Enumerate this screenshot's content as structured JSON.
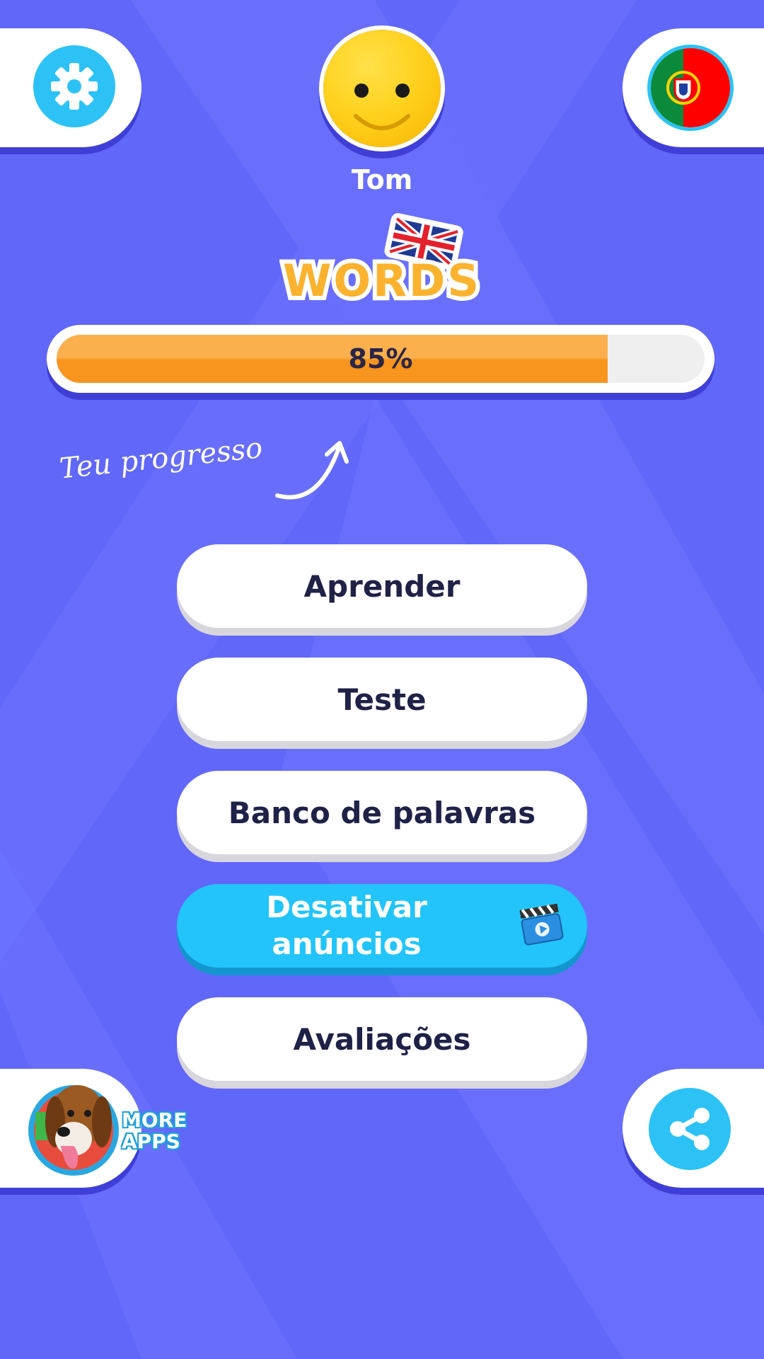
{
  "user": {
    "name": "Tom"
  },
  "logo": {
    "text": "WORDS"
  },
  "progress": {
    "percent": 85,
    "label": "85%"
  },
  "hint": {
    "text": "Teu progresso"
  },
  "menu": {
    "learn": "Aprender",
    "test": "Teste",
    "word_bank": "Banco de palavras",
    "remove_ads_line1": "Desativar",
    "remove_ads_line2": "anúncios",
    "reviews": "Avaliações"
  },
  "more_apps": {
    "line1": "MORE",
    "line2": "APPS"
  },
  "icons": {
    "settings": "gear-icon",
    "language": "portugal-flag-icon",
    "share": "share-icon",
    "ad_video": "clapperboard-icon",
    "more_apps": "dog-icon"
  },
  "colors": {
    "background": "#6167f9",
    "accent_blue": "#22c4fb",
    "progress_orange": "#f7951f",
    "text_dark": "#1f2147"
  }
}
